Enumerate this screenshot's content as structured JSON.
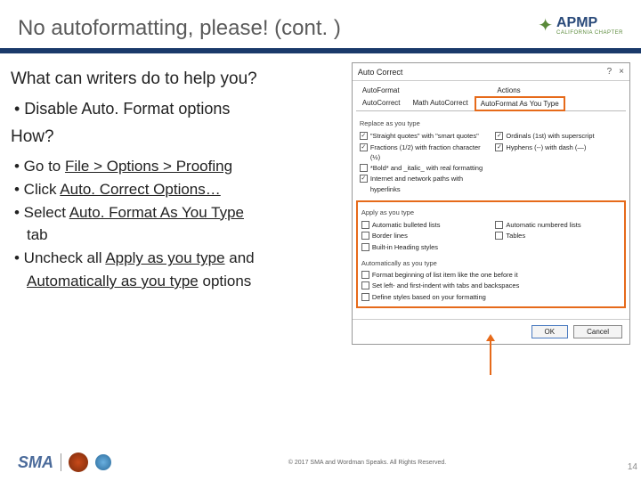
{
  "title": "No autoformatting, please! (cont. )",
  "logo": {
    "brand": "APMP",
    "sub": "CALIFORNIA CHAPTER"
  },
  "left": {
    "question": "What can writers do to help you?",
    "bullet1": "• Disable Auto. Format options",
    "how": "How?",
    "steps": {
      "s1a": "• Go to ",
      "s1b": "File > Options > Proofing",
      "s2a": "• Click ",
      "s2b": "Auto. Correct Options…",
      "s3a": "• Select ",
      "s3b": "Auto. Format As You Type",
      "s3c": "  tab",
      "s4a": "• Uncheck all ",
      "s4b": "Apply as you type",
      "s4c": " and",
      "s5a": "  ",
      "s5b": "Automatically as you type",
      "s5c": " options"
    }
  },
  "dialog": {
    "title": "Auto Correct",
    "help": "?",
    "close": "×",
    "tabs_row1": {
      "t1": "AutoFormat",
      "t2": "Actions"
    },
    "tabs_row2": {
      "t1": "AutoCorrect",
      "t2": "Math AutoCorrect",
      "t3": "AutoFormat As You Type"
    },
    "replace_label": "Replace as you type",
    "replace": {
      "c1": "\"Straight quotes\" with \"smart quotes\"",
      "c2": "Ordinals (1st) with superscript",
      "c3": "Fractions (1/2) with fraction character (½)",
      "c4": "Hyphens (--) with dash (—)",
      "c5": "*Bold* and _italic_ with real formatting",
      "c6": "Internet and network paths with hyperlinks"
    },
    "apply_label": "Apply as you type",
    "apply": {
      "c1": "Automatic bulleted lists",
      "c2": "Automatic numbered lists",
      "c3": "Border lines",
      "c4": "Tables",
      "c5": "Built-in Heading styles"
    },
    "auto_label": "Automatically as you type",
    "auto": {
      "c1": "Format beginning of list item like the one before it",
      "c2": "Set left- and first-indent with tabs and backspaces",
      "c3": "Define styles based on your formatting"
    },
    "ok": "OK",
    "cancel": "Cancel"
  },
  "footer": {
    "copyright": "© 2017 SMA and Wordman Speaks. All Rights Reserved.",
    "brand": "SMA",
    "page": "14"
  }
}
